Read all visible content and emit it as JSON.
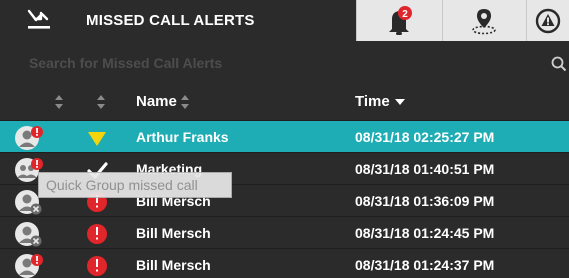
{
  "tabs": {
    "active_label": "MISSED CALL ALERTS",
    "active_icon": "missed-call-icon",
    "alerts_badge": "2",
    "alerts_icon": "bell-alert-icon",
    "location_icon": "location-pin-icon",
    "warning_icon": "warning-circle-icon"
  },
  "search": {
    "placeholder": "Search for Missed Call Alerts",
    "icon": "search-icon"
  },
  "table": {
    "columns": {
      "name": "Name",
      "time": "Time"
    },
    "sort": {
      "active_column": "time",
      "direction": "descending"
    },
    "rows": [
      {
        "avatar": "person-alert-icon",
        "status": "unread-triangle-icon",
        "name": "Arthur Franks",
        "time": "08/31/18 02:25:27 PM",
        "selected": true
      },
      {
        "avatar": "group-alert-icon",
        "status": "checkmark-icon",
        "name": "Marketing",
        "time": "08/31/18 01:40:51 PM",
        "selected": false
      },
      {
        "avatar": "person-blocked-icon",
        "status": "clock-alert-icon",
        "name": "Bill Mersch",
        "time": "08/31/18 01:36:09 PM",
        "selected": false
      },
      {
        "avatar": "person-blocked-icon",
        "status": "clock-alert-icon",
        "name": "Bill Mersch",
        "time": "08/31/18 01:24:45 PM",
        "selected": false
      },
      {
        "avatar": "person-alert-icon",
        "status": "clock-alert-icon",
        "name": "Bill Mersch",
        "time": "08/31/18 01:24:37 PM",
        "selected": false
      }
    ]
  },
  "tooltip": {
    "text": "Quick Group missed call"
  },
  "colors": {
    "panel_bg": "#2b2b2b",
    "selected_row": "#1fadb5",
    "badge_red": "#e0262b",
    "triangle_yellow": "#f4d50c",
    "tab_inactive_bg": "#e7e7e7"
  }
}
